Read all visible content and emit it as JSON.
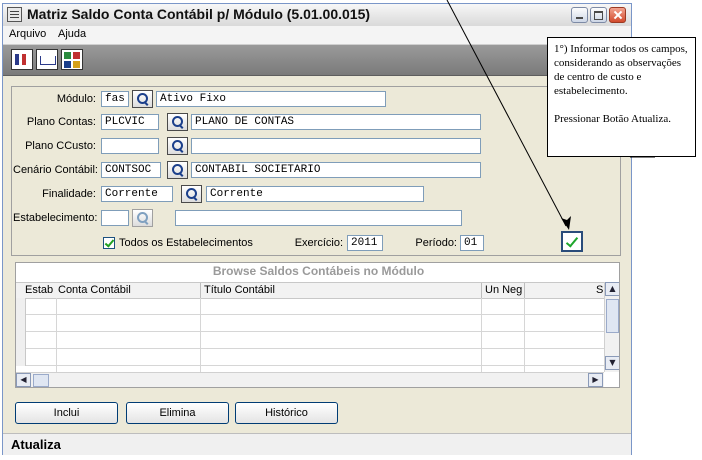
{
  "window": {
    "title": "Matriz Saldo Conta Contábil p/ Módulo (5.01.00.015)",
    "menu": [
      "Arquivo",
      "Ajuda"
    ]
  },
  "form": {
    "modulo": {
      "label": "Módulo:",
      "code": "fas",
      "desc": "Ativo Fixo"
    },
    "plano_contas": {
      "label": "Plano Contas:",
      "code": "PLCVIC",
      "desc": "PLANO DE CONTAS"
    },
    "plano_ccusto": {
      "label": "Plano CCusto:",
      "code": "",
      "desc": ""
    },
    "cenario": {
      "label": "Cenário Contábil:",
      "code": "CONTSOC",
      "desc": "CONTABIL SOCIETARIO"
    },
    "finalidade": {
      "label": "Finalidade:",
      "code": "Corrente",
      "desc": "Corrente"
    },
    "estabelecimento": {
      "label": "Estabelecimento:",
      "code": "",
      "desc": ""
    },
    "todos_estab": {
      "label": "Todos os Estabelecimentos",
      "checked": true
    },
    "exercicio": {
      "label": "Exercício:",
      "value": "2011"
    },
    "periodo": {
      "label": "Período:",
      "value": "01"
    }
  },
  "browse": {
    "caption": "Browse Saldos Contábeis no Módulo",
    "columns": [
      "Estab",
      "Conta Contábil",
      "Título Contábil",
      "Un Neg",
      "S"
    ]
  },
  "buttons": {
    "inclui": "Inclui",
    "elimina": "Elimina",
    "historico": "Histórico"
  },
  "status": "Atualiza",
  "note": {
    "line1": "1°) Informar  todos os campos, considerando as observações de centro de custo e estabelecimento.",
    "line2": "Pressionar Botão Atualiza."
  }
}
